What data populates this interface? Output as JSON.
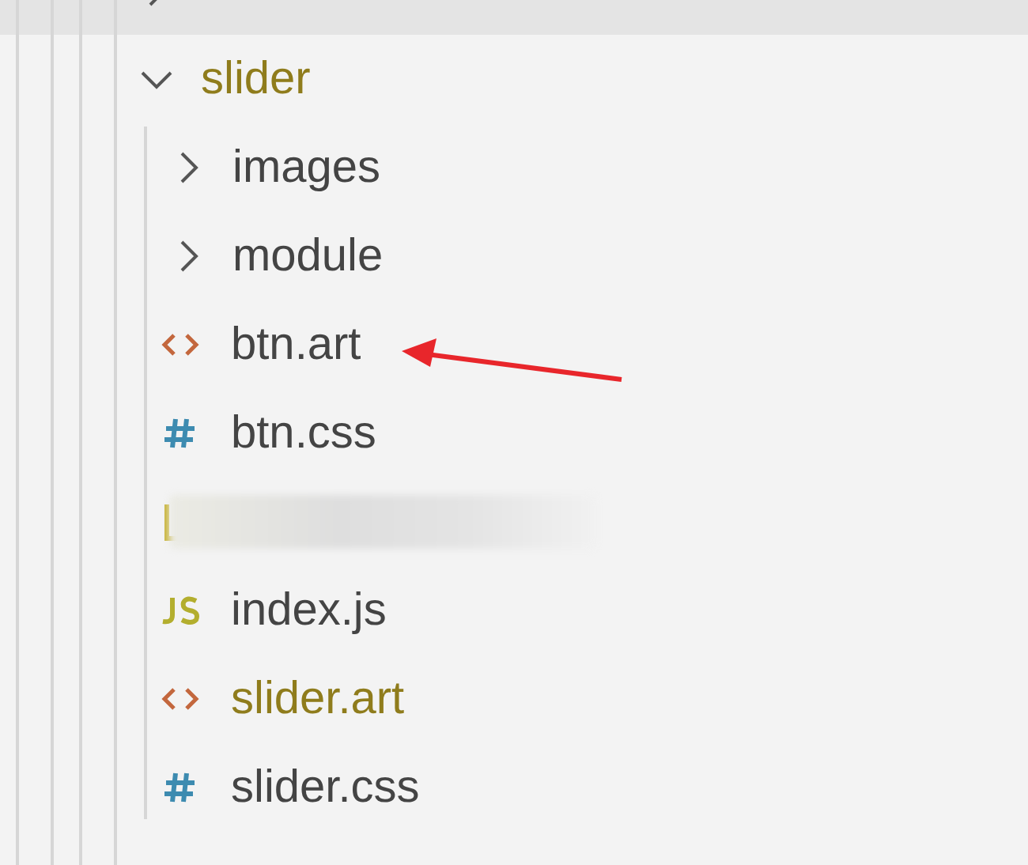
{
  "tree": [
    {
      "kind": "folder",
      "expanded": false,
      "hovered": true
    },
    {
      "kind": "folder",
      "label": "slider",
      "expanded": true,
      "modified": true,
      "hovered": false,
      "children": [
        {
          "kind": "folder",
          "label": "images",
          "expanded": false,
          "modified": false,
          "hovered": false
        },
        {
          "kind": "folder",
          "label": "module",
          "expanded": false,
          "modified": false,
          "hovered": false
        },
        {
          "kind": "art",
          "label": "btn.art",
          "modified": false,
          "hovered": false
        },
        {
          "kind": "css",
          "label": "btn.css",
          "modified": false,
          "hovered": false
        },
        {
          "kind": "redacted",
          "hovered": false
        },
        {
          "kind": "js",
          "label": "index.js",
          "modified": false,
          "hovered": false
        },
        {
          "kind": "art",
          "label": "slider.art",
          "modified": true,
          "hovered": false
        },
        {
          "kind": "css",
          "label": "slider.css",
          "modified": false,
          "hovered": false
        }
      ]
    }
  ]
}
